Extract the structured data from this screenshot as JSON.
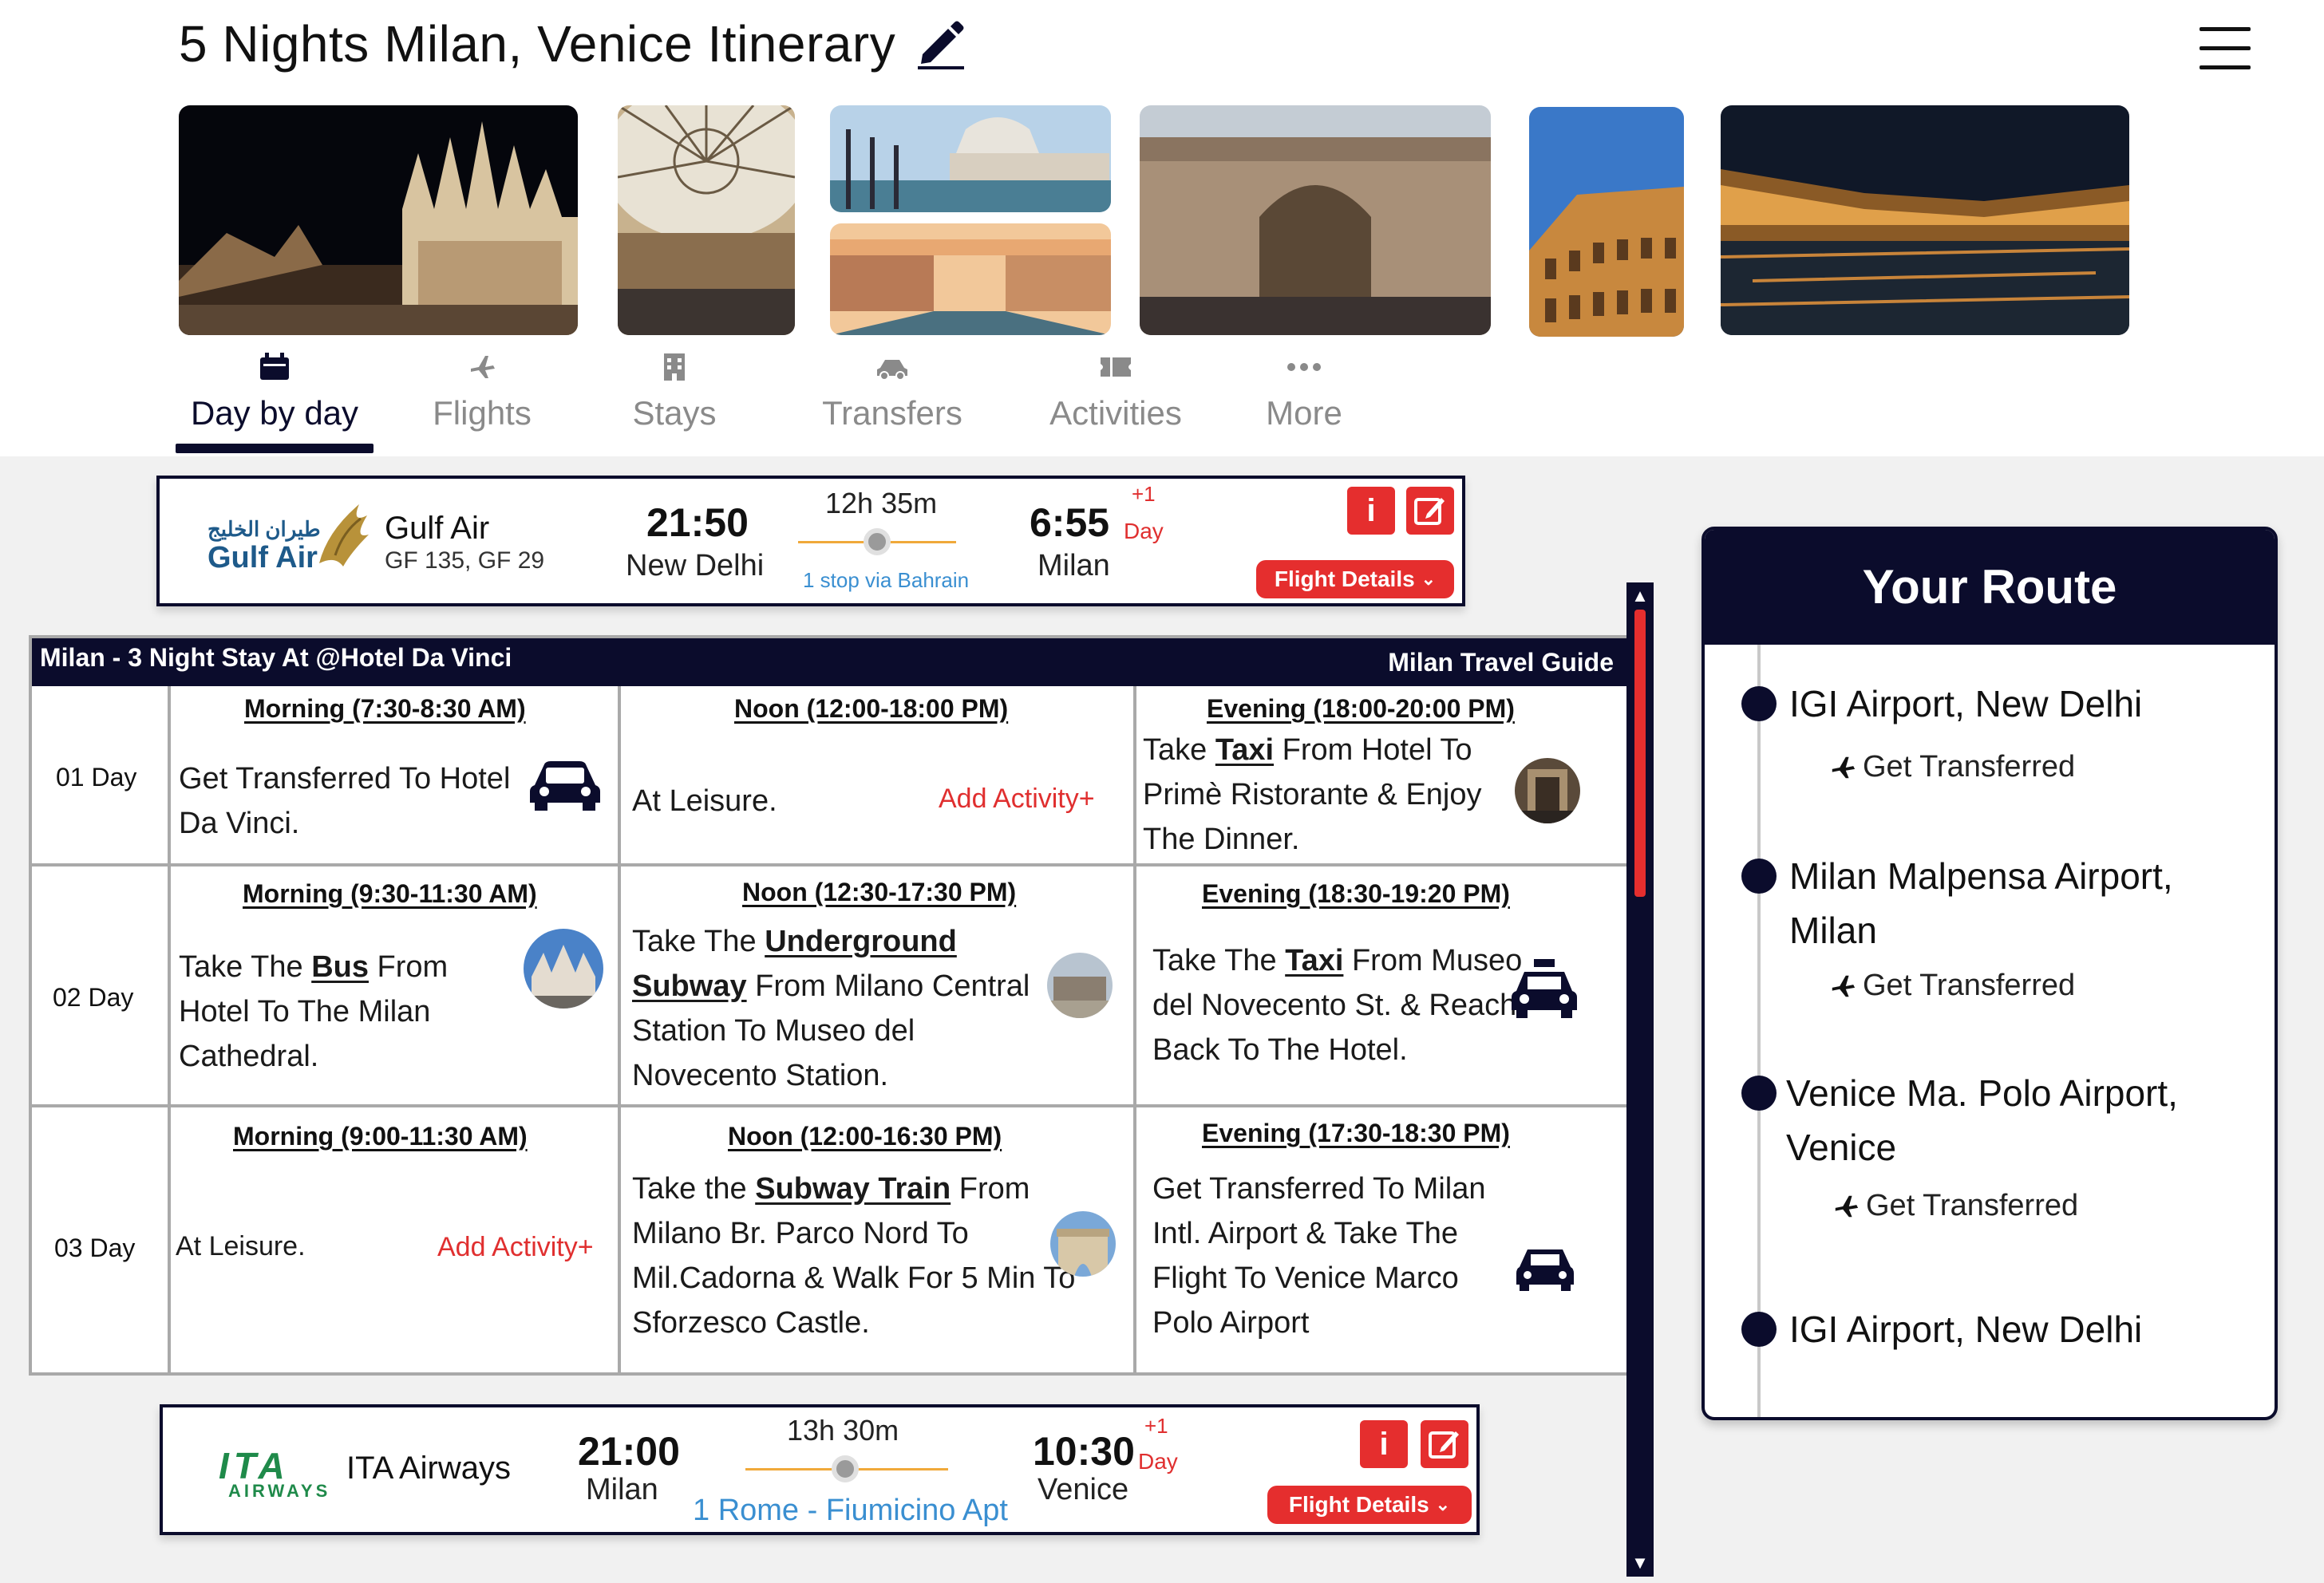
{
  "page": {
    "title": "5 Nights Milan, Venice Itinerary",
    "edit_icon": "pencil-icon",
    "menu_icon": "hamburger-menu-icon"
  },
  "tabs": [
    {
      "label": "Day by day",
      "icon": "calendar-icon",
      "active": true
    },
    {
      "label": "Flights",
      "icon": "airplane-icon",
      "active": false
    },
    {
      "label": "Stays",
      "icon": "hotel-icon",
      "active": false
    },
    {
      "label": "Transfers",
      "icon": "car-icon",
      "active": false
    },
    {
      "label": "Activities",
      "icon": "ticket-icon",
      "active": false
    },
    {
      "label": "More",
      "icon": "dots-icon",
      "active": false
    }
  ],
  "flight_outbound": {
    "logo_arabic": "طيران الخليج",
    "logo_text": "Gulf Air",
    "airline": "Gulf Air",
    "codes": "GF 135, GF 29",
    "depart_time": "21:50",
    "depart_city": "New Delhi",
    "duration": "12h 35m",
    "stops": "1 stop via Bahrain",
    "arrive_time": "6:55",
    "arrive_city": "Milan",
    "plus_day": "+1",
    "day_word": "Day",
    "info_label": "i",
    "details_label": "Flight Details"
  },
  "stay": {
    "title": "Milan - 3 Night Stay At @Hotel Da Vinci",
    "guide": "Milan Travel Guide",
    "days": [
      {
        "label": "01 Day",
        "morning_head": "Morning (7:30-8:30 AM)",
        "morning_text": "Get Transferred To Hotel Da Vinci.",
        "noon_head": "Noon (12:00-18:00 PM)",
        "noon_text": "At Leisure.",
        "noon_add": "Add Activity+",
        "evening_head": "Evening (18:00-20:00 PM)",
        "evening_pre": "Take ",
        "evening_bold": "Taxi",
        "evening_post": " From Hotel To Primè Ristorante & Enjoy The Dinner."
      },
      {
        "label": "02 Day",
        "morning_head": "Morning (9:30-11:30 AM)",
        "morning_pre": "Take The ",
        "morning_bold": "Bus",
        "morning_post": " From Hotel To The Milan Cathedral.",
        "noon_head": "Noon (12:30-17:30 PM)",
        "noon_pre": "Take The ",
        "noon_bold": "Underground Subway",
        "noon_post": " From Milano Central Station To Museo del Novecento Station.",
        "evening_head": "Evening (18:30-19:20 PM)",
        "evening_pre": "Take The ",
        "evening_bold": "Taxi",
        "evening_post": " From Museo del Novecento St. & Reach Back To The Hotel."
      },
      {
        "label": "03 Day",
        "morning_head": "Morning (9:00-11:30 AM)",
        "morning_text": "At Leisure.",
        "morning_add": "Add Activity+",
        "noon_head": "Noon (12:00-16:30 PM)",
        "noon_pre": "Take the ",
        "noon_bold": "Subway Train",
        "noon_post": " From Milano Br. Parco Nord To Mil.Cadorna & Walk For 5 Min To Sforzesco Castle.",
        "evening_head": "Evening (17:30-18:30 PM)",
        "evening_text": "Get Transferred To Milan Intl. Airport & Take The Flight To Venice Marco Polo Airport"
      }
    ]
  },
  "flight_return": {
    "logo_text": "ITA",
    "logo_sub": "AIRWAYS",
    "airline": "ITA Airways",
    "depart_time": "21:00",
    "depart_city": "Milan",
    "duration": "13h 30m",
    "stops": "1 Rome - Fiumicino Apt",
    "arrive_time": "10:30",
    "arrive_city": "Venice",
    "plus_day": "+1",
    "day_word": "Day",
    "info_label": "i",
    "details_label": "Flight Details"
  },
  "route": {
    "title": "Your Route",
    "stops": [
      "IGI Airport, New Delhi",
      "Milan Malpensa Airport, Milan",
      "Venice Ma. Polo Airport, Venice",
      "IGI Airport, New Delhi"
    ],
    "transfer_label": "Get Transferred"
  },
  "colors": {
    "navy": "#0b0c2c",
    "accent_red": "#e52e2e",
    "link_blue": "#3a8fd1",
    "timeline_orange": "#f0a93a"
  }
}
